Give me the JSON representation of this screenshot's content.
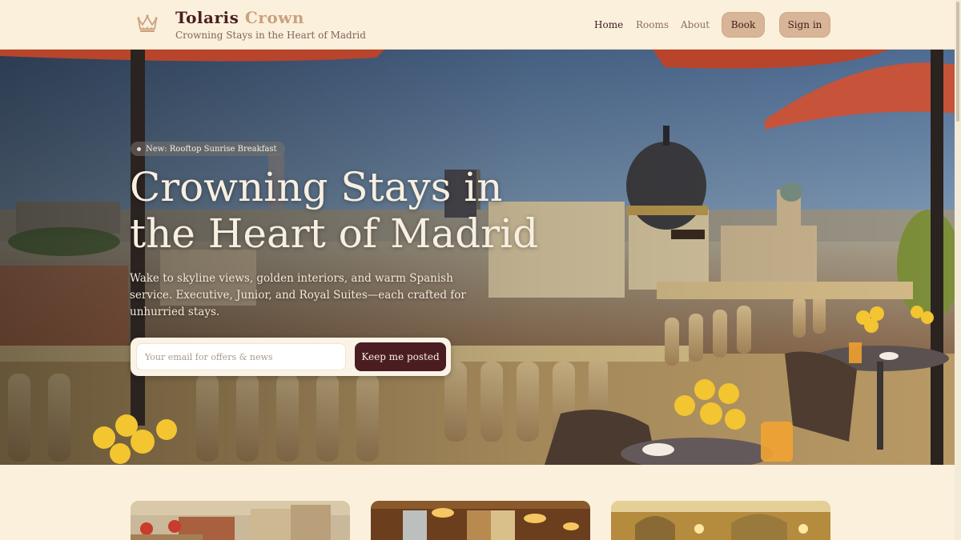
{
  "brand": {
    "name_part1": "Tolaris",
    "name_part2": "Crown",
    "tagline": "Crowning Stays in the Heart of Madrid",
    "logo_icon": "crown-icon"
  },
  "nav": {
    "links": [
      {
        "label": "Home",
        "active": true
      },
      {
        "label": "Rooms",
        "active": false
      },
      {
        "label": "About",
        "active": false
      }
    ],
    "book_label": "Book",
    "signin_label": "Sign in"
  },
  "hero": {
    "badge": "New: Rooftop Sunrise Breakfast",
    "title_line1": "Crowning Stays in",
    "title_line2": "the Heart of Madrid",
    "subtitle": "Wake to skyline views, golden interiors, and warm Spanish service. Executive, Junior, and Royal Suites—each crafted for unhurried stays.",
    "email_placeholder": "Your email for offers & news",
    "email_value": "",
    "submit_label": "Keep me posted",
    "image_subject": "rooftop-terrace-madrid-skyline"
  },
  "rooms": {
    "cards": [
      {
        "image_subject": "madrid-rooftops"
      },
      {
        "image_subject": "golden-dining-room"
      },
      {
        "image_subject": "royal-suite-arches"
      }
    ]
  },
  "colors": {
    "background": "#fbf0dc",
    "brand_dark": "#4a1d22",
    "brand_gold": "#caa27f",
    "pill_button": "#d8b596",
    "text_dark": "#3d1c1c"
  }
}
